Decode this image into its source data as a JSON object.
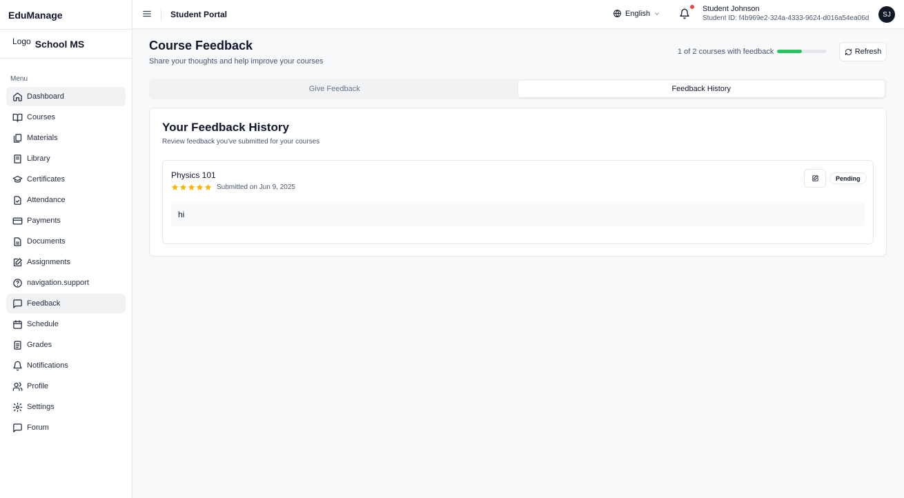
{
  "sidebar": {
    "brand": "EduManage",
    "logo_text": "Logo",
    "school_name": "School MS",
    "menu_label": "Menu",
    "items": [
      {
        "label": "Dashboard",
        "icon": "home-icon"
      },
      {
        "label": "Courses",
        "icon": "book-open-icon"
      },
      {
        "label": "Materials",
        "icon": "files-icon"
      },
      {
        "label": "Library",
        "icon": "book-icon"
      },
      {
        "label": "Certificates",
        "icon": "graduation-cap-icon"
      },
      {
        "label": "Attendance",
        "icon": "file-check-icon"
      },
      {
        "label": "Payments",
        "icon": "credit-card-icon"
      },
      {
        "label": "Documents",
        "icon": "file-text-icon"
      },
      {
        "label": "Assignments",
        "icon": "pencil-square-icon"
      },
      {
        "label": "navigation.support",
        "icon": "help-circle-icon"
      },
      {
        "label": "Feedback",
        "icon": "message-square-icon"
      },
      {
        "label": "Schedule",
        "icon": "calendar-icon"
      },
      {
        "label": "Grades",
        "icon": "clipboard-list-icon"
      },
      {
        "label": "Notifications",
        "icon": "bell-icon"
      },
      {
        "label": "Profile",
        "icon": "users-icon"
      },
      {
        "label": "Settings",
        "icon": "gear-icon"
      },
      {
        "label": "Forum",
        "icon": "message-square-icon"
      }
    ]
  },
  "topbar": {
    "title": "Student Portal",
    "language": "English",
    "user_name": "Student Johnson",
    "user_id": "Student ID: f4b969e2-324a-4333-9624-d016a54ea06d",
    "avatar_initials": "SJ"
  },
  "page": {
    "title": "Course Feedback",
    "subtitle": "Share your thoughts and help improve your courses",
    "progress_text": "1 of 2 courses with feedback",
    "progress_fraction": 0.5,
    "refresh_label": "Refresh"
  },
  "tabs": [
    {
      "label": "Give Feedback"
    },
    {
      "label": "Feedback History"
    }
  ],
  "history": {
    "title": "Your Feedback History",
    "subtitle": "Review feedback you've submitted for your courses",
    "entries": [
      {
        "course": "Physics 101",
        "rating": 5,
        "submitted": "Submitted on Jun 9, 2025",
        "status": "Pending",
        "comment": "hi"
      }
    ]
  },
  "colors": {
    "accent_progress": "#22c55e",
    "star": "#f5b700",
    "notification_dot": "#ef4444",
    "avatar_bg": "#111827"
  }
}
